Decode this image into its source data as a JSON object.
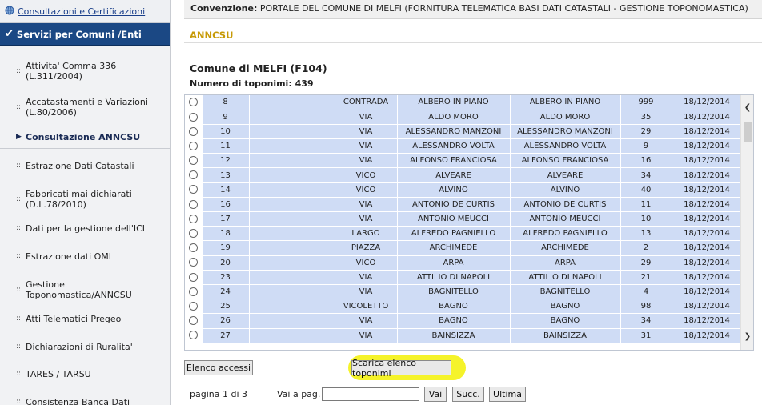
{
  "sidebar": {
    "top_link": "Consultazioni e Certificazioni",
    "active_section": "Servizi per Comuni /Enti",
    "items": [
      {
        "label": "Attivita' Comma 336 (L.311/2004)"
      },
      {
        "label": "Accatastamenti e Variazioni (L.80/2006)"
      },
      {
        "label": "Consultazione ANNCSU",
        "selected": true
      },
      {
        "label": "Estrazione Dati Catastali"
      },
      {
        "label": "Fabbricati mai dichiarati (D.L.78/2010)"
      },
      {
        "label": "Dati per la gestione dell'ICI"
      },
      {
        "label": "Estrazione dati OMI"
      },
      {
        "label": "Gestione Toponomastica/ANNCSU"
      },
      {
        "label": "Atti Telematici Pregeo"
      },
      {
        "label": "Dichiarazioni di Ruralita'"
      },
      {
        "label": "TARES / TARSU"
      },
      {
        "label": "Consistenza Banca Dati"
      }
    ]
  },
  "header": {
    "convenzione_label": "Convenzione:",
    "convenzione_value": "PORTALE DEL COMUNE DI MELFI (FORNITURA TELEMATICA BASI DATI CATASTALI - GESTIONE TOPONOMASTICA)"
  },
  "section_title": "ANNCSU",
  "comune": "Comune di MELFI (F104)",
  "numero_label": "Numero di toponimi:",
  "numero_value": "439",
  "table": {
    "rows": [
      [
        "8",
        "",
        "CONTRADA",
        "ALBERO IN PIANO",
        "ALBERO IN PIANO",
        "999",
        "18/12/2014"
      ],
      [
        "9",
        "",
        "VIA",
        "ALDO MORO",
        "ALDO MORO",
        "35",
        "18/12/2014"
      ],
      [
        "10",
        "",
        "VIA",
        "ALESSANDRO MANZONI",
        "ALESSANDRO MANZONI",
        "29",
        "18/12/2014"
      ],
      [
        "11",
        "",
        "VIA",
        "ALESSANDRO VOLTA",
        "ALESSANDRO VOLTA",
        "9",
        "18/12/2014"
      ],
      [
        "12",
        "",
        "VIA",
        "ALFONSO FRANCIOSA",
        "ALFONSO FRANCIOSA",
        "16",
        "18/12/2014"
      ],
      [
        "13",
        "",
        "VICO",
        "ALVEARE",
        "ALVEARE",
        "34",
        "18/12/2014"
      ],
      [
        "14",
        "",
        "VICO",
        "ALVINO",
        "ALVINO",
        "40",
        "18/12/2014"
      ],
      [
        "16",
        "",
        "VIA",
        "ANTONIO DE CURTIS",
        "ANTONIO DE CURTIS",
        "11",
        "18/12/2014"
      ],
      [
        "17",
        "",
        "VIA",
        "ANTONIO MEUCCI",
        "ANTONIO MEUCCI",
        "10",
        "18/12/2014"
      ],
      [
        "18",
        "",
        "LARGO",
        "ALFREDO PAGNIELLO",
        "ALFREDO PAGNIELLO",
        "13",
        "18/12/2014"
      ],
      [
        "19",
        "",
        "PIAZZA",
        "ARCHIMEDE",
        "ARCHIMEDE",
        "2",
        "18/12/2014"
      ],
      [
        "20",
        "",
        "VICO",
        "ARPA",
        "ARPA",
        "29",
        "18/12/2014"
      ],
      [
        "23",
        "",
        "VIA",
        "ATTILIO DI NAPOLI",
        "ATTILIO DI NAPOLI",
        "21",
        "18/12/2014"
      ],
      [
        "24",
        "",
        "VIA",
        "BAGNITELLO",
        "BAGNITELLO",
        "4",
        "18/12/2014"
      ],
      [
        "25",
        "",
        "VICOLETTO",
        "BAGNO",
        "BAGNO",
        "98",
        "18/12/2014"
      ],
      [
        "26",
        "",
        "VIA",
        "BAGNO",
        "BAGNO",
        "34",
        "18/12/2014"
      ],
      [
        "27",
        "",
        "VIA",
        "BAINSIZZA",
        "BAINSIZZA",
        "31",
        "18/12/2014"
      ]
    ]
  },
  "buttons": {
    "elenco_accessi": "Elenco accessi",
    "scarica": "Scarica elenco toponimi",
    "vai": "Vai",
    "succ": "Succ.",
    "ultima": "Ultima"
  },
  "pager": {
    "page_info": "pagina 1 di 3",
    "goto_label": "Vai a pag.",
    "goto_value": ""
  }
}
